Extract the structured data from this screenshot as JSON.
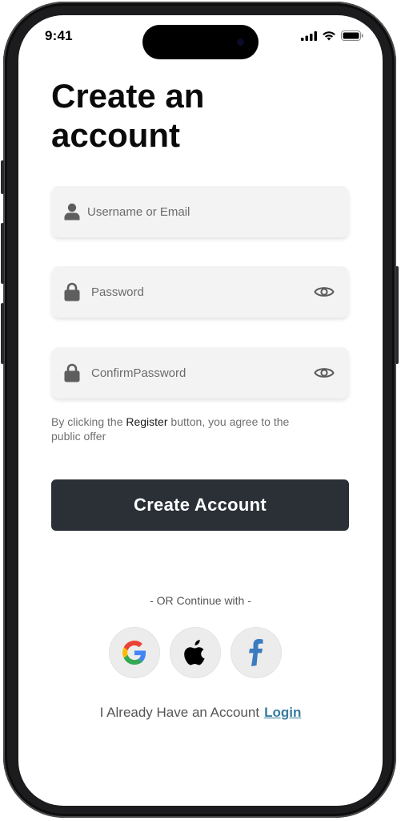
{
  "status_bar": {
    "time": "9:41"
  },
  "title": {
    "line1": "Create an",
    "line2": "account"
  },
  "fields": {
    "username": {
      "placeholder": "Username or Email",
      "value": ""
    },
    "password": {
      "placeholder": "Password",
      "value": ""
    },
    "confirm_password": {
      "placeholder": "ConfirmPassword",
      "value": ""
    }
  },
  "agreement": {
    "prefix": "By clicking the ",
    "highlight": "Register",
    "suffix": " button, you agree to the public offer"
  },
  "create_button": {
    "label": "Create Account"
  },
  "social": {
    "divider": "- OR Continue with -",
    "providers": [
      "google-icon",
      "apple-icon",
      "facebook-icon"
    ]
  },
  "footer": {
    "prompt": "I Already Have an Account",
    "link": "Login"
  },
  "colors": {
    "button_bg": "#2a3036",
    "link": "#3a7ca0",
    "field_bg": "#f3f3f3",
    "facebook_blue": "#3b7bbf"
  }
}
